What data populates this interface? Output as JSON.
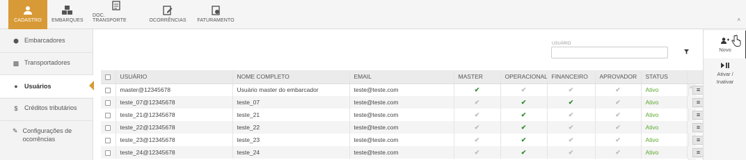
{
  "top_nav": [
    {
      "label": "CADASTRO",
      "icon": "user-icon",
      "active": true
    },
    {
      "label": "EMBARQUES",
      "icon": "boxes-icon",
      "active": false
    },
    {
      "label": "DOC. TRANSPORTE",
      "icon": "document-icon",
      "active": false
    },
    {
      "label": "OCORRÊNCIAS",
      "icon": "edit-document-icon",
      "active": false
    },
    {
      "label": "FATURAMENTO",
      "icon": "invoice-icon",
      "active": false
    }
  ],
  "accent_color": "#d89a36",
  "sidebar": {
    "items": [
      {
        "label": "Embarcadores",
        "icon": "cube-icon"
      },
      {
        "label": "Transportadores",
        "icon": "truck-icon"
      },
      {
        "label": "Usuários",
        "icon": "users-icon",
        "active": true
      },
      {
        "label": "Créditos tributários",
        "icon": "dollar-icon"
      },
      {
        "label": "Configurações de ocorrências",
        "icon": "edit-icon"
      }
    ]
  },
  "filter": {
    "label": "USUÁRIO",
    "value": "",
    "icon": "filter-icon"
  },
  "table": {
    "headers": [
      "USUÁRIO",
      "NOME COMPLETO",
      "EMAIL",
      "MASTER",
      "OPERACIONAL",
      "FINANCEIRO",
      "APROVADOR",
      "STATUS"
    ],
    "rows": [
      {
        "usuario": "master@12345678",
        "nome": "Usuário master do embarcador",
        "email": "teste@teste.com",
        "master": true,
        "operacional": false,
        "financeiro": false,
        "aprovador": false,
        "status": "Ativo"
      },
      {
        "usuario": "teste_07@12345678",
        "nome": "teste_07",
        "email": "teste@teste.com",
        "master": false,
        "operacional": true,
        "financeiro": true,
        "aprovador": false,
        "status": "Ativo"
      },
      {
        "usuario": "teste_21@12345678",
        "nome": "teste_21",
        "email": "teste@teste.com",
        "master": false,
        "operacional": true,
        "financeiro": false,
        "aprovador": false,
        "status": "Ativo"
      },
      {
        "usuario": "teste_22@12345678",
        "nome": "teste_22",
        "email": "teste@teste.com",
        "master": false,
        "operacional": true,
        "financeiro": false,
        "aprovador": false,
        "status": "Ativo"
      },
      {
        "usuario": "teste_23@12345678",
        "nome": "teste_23",
        "email": "teste@teste.com",
        "master": false,
        "operacional": true,
        "financeiro": false,
        "aprovador": false,
        "status": "Ativo"
      },
      {
        "usuario": "teste_24@12345678",
        "nome": "teste_24",
        "email": "teste@teste.com",
        "master": false,
        "operacional": true,
        "financeiro": false,
        "aprovador": false,
        "status": "Ativo"
      }
    ]
  },
  "right_panel": {
    "novo_label": "Novo",
    "ativar_label": "Ativar / Inativar"
  }
}
